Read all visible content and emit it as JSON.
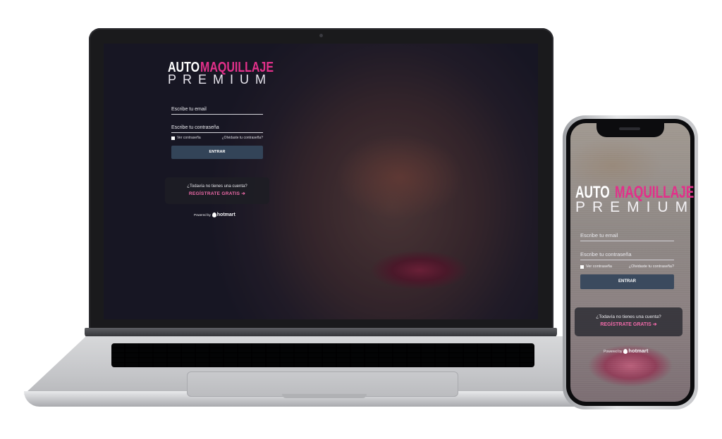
{
  "brand": {
    "auto": "AUTO",
    "maquillaje": "MAQUILLAJE",
    "premium": "PREMIUM",
    "colors": {
      "accent": "#e2308a",
      "white": "#ffffff"
    }
  },
  "login": {
    "email_label": "Escribe tu email",
    "password_label": "Escribe tu contraseña",
    "show_password": "Ver contraseña",
    "forgot_password": "¿Olvidaste tu contraseña?",
    "submit_label": "ENTRAR",
    "button_color": "#334458"
  },
  "register": {
    "question": "¿Todavía no tienes una cuenta?",
    "link_label": "REGÍSTRATE GRATIS",
    "arrow_icon": "arrow-right-icon",
    "link_color": "#f06aa9"
  },
  "footer": {
    "powered_by": "Powered by",
    "provider": "hotmart",
    "logo_icon": "hotmart-flame-icon"
  }
}
